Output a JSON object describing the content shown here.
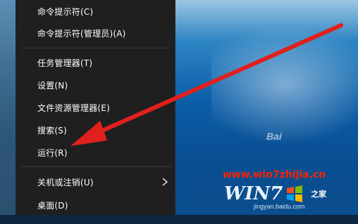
{
  "menu": {
    "items": [
      {
        "label": "命令提示符(C)"
      },
      {
        "label": "命令提示符(管理员)(A)"
      },
      {
        "label": "任务管理器(T)"
      },
      {
        "label": "设置(N)"
      },
      {
        "label": "文件资源管理器(E)"
      },
      {
        "label": "搜索(S)"
      },
      {
        "label": "运行(R)"
      },
      {
        "label": "关机或注销(U)",
        "has_submenu": true
      },
      {
        "label": "桌面(D)"
      }
    ]
  },
  "watermark": {
    "url": "www.win7zhijia.cn",
    "logo_left": "WIN7",
    "logo_right": "之家",
    "sub": "jingyan.baidu.com",
    "baidu": "Bai"
  },
  "colors": {
    "menu_bg": "#1f1f1f",
    "arrow": "#e0201c",
    "watermark_red": "#ff2200"
  }
}
